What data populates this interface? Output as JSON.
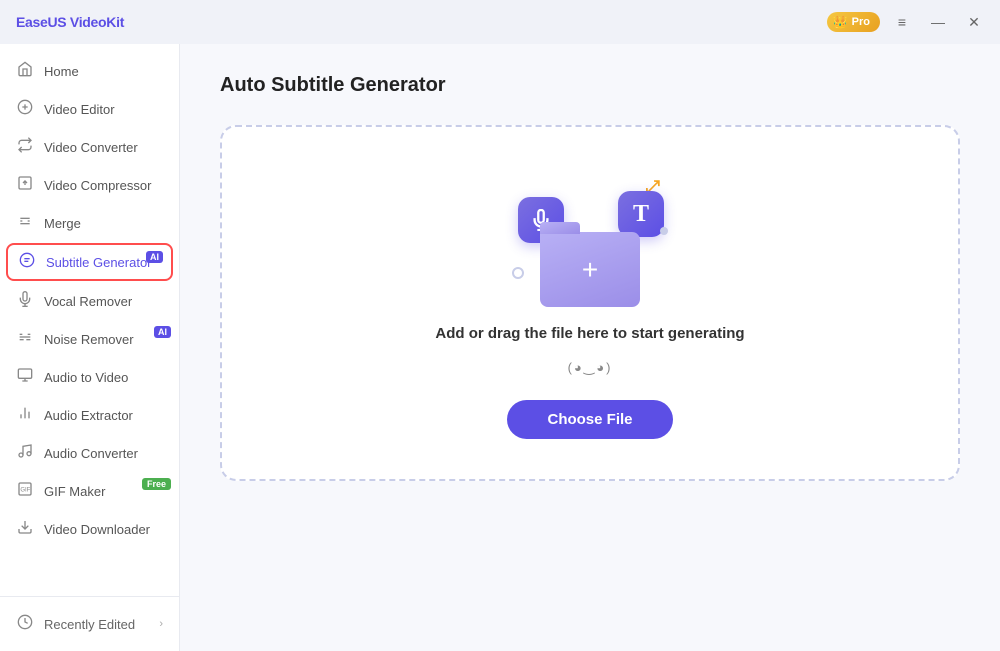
{
  "app": {
    "name": "EaseUS VideoKit",
    "pro_label": "Pro"
  },
  "window_controls": {
    "menu_label": "≡",
    "minimize_label": "—",
    "close_label": "✕"
  },
  "sidebar": {
    "items": [
      {
        "id": "home",
        "label": "Home",
        "icon": "🏠",
        "badge": null
      },
      {
        "id": "video-editor",
        "label": "Video Editor",
        "icon": "✂",
        "badge": null
      },
      {
        "id": "video-converter",
        "label": "Video Converter",
        "icon": "🔄",
        "badge": null
      },
      {
        "id": "video-compressor",
        "label": "Video Compressor",
        "icon": "📄",
        "badge": null
      },
      {
        "id": "merge",
        "label": "Merge",
        "icon": "⚙",
        "badge": null
      },
      {
        "id": "subtitle-generator",
        "label": "Subtitle Generator",
        "icon": "🎵",
        "badge": "AI",
        "active": true
      },
      {
        "id": "vocal-remover",
        "label": "Vocal Remover",
        "icon": "🎤",
        "badge": null
      },
      {
        "id": "noise-remover",
        "label": "Noise Remover",
        "icon": "🎛",
        "badge": "AI"
      },
      {
        "id": "audio-to-video",
        "label": "Audio to Video",
        "icon": "📺",
        "badge": null
      },
      {
        "id": "audio-extractor",
        "label": "Audio Extractor",
        "icon": "📊",
        "badge": null
      },
      {
        "id": "audio-converter",
        "label": "Audio Converter",
        "icon": "🎵",
        "badge": null
      },
      {
        "id": "gif-maker",
        "label": "GIF Maker",
        "icon": "🖼",
        "badge": "Free"
      },
      {
        "id": "video-downloader",
        "label": "Video Downloader",
        "icon": "⬇",
        "badge": null
      }
    ],
    "bottom": {
      "label": "Recently Edited",
      "icon": "⏰"
    }
  },
  "main": {
    "title": "Auto Subtitle Generator",
    "drop_zone": {
      "main_text": "Add or drag the file here to start generating",
      "sub_text": "(◕‿◕)",
      "button_label": "Choose File"
    }
  }
}
